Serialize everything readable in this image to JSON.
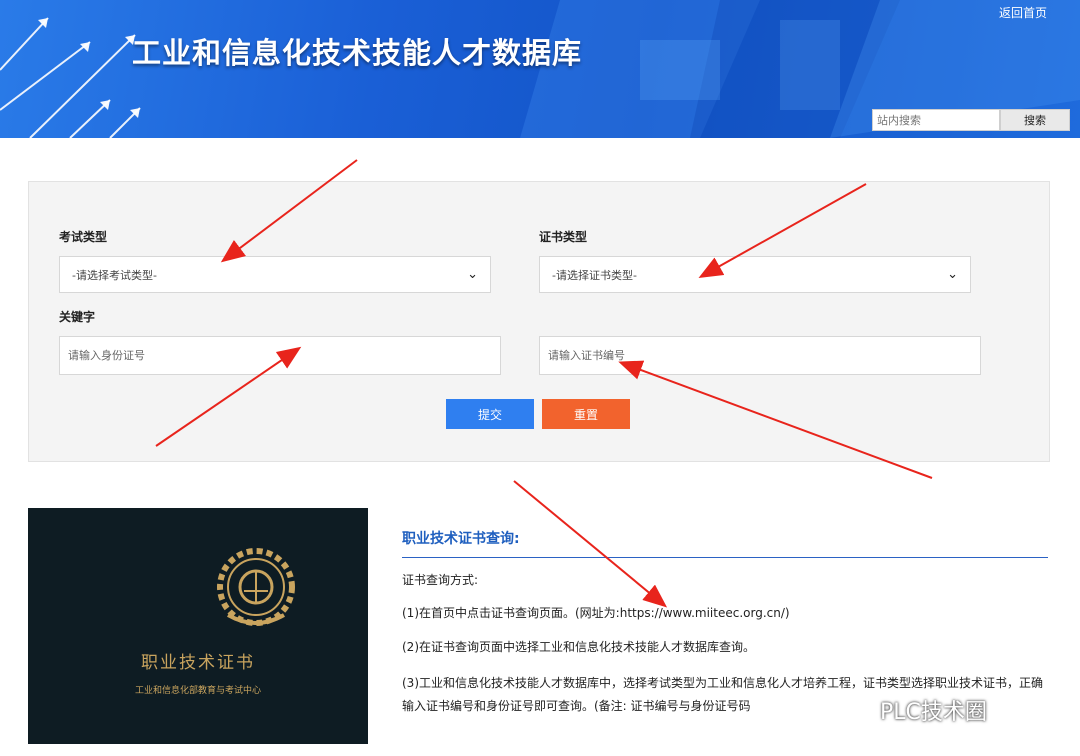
{
  "header": {
    "title": "工业和信息化技术技能人才数据库",
    "home_link": "返回首页",
    "search_placeholder": "站内搜索",
    "search_button": "搜索"
  },
  "form": {
    "exam_type_label": "考试类型",
    "exam_type_value": "-请选择考试类型-",
    "cert_type_label": "证书类型",
    "cert_type_value": "-请选择证书类型-",
    "keyword_label": "关键字",
    "id_placeholder": "请输入身份证号",
    "cert_no_placeholder": "请输入证书编号",
    "submit_label": "提交",
    "reset_label": "重置"
  },
  "certificate_image": {
    "title": "职业技术证书",
    "subtitle": "工业和信息化部教育与考试中心"
  },
  "info": {
    "title": "职业技术证书查询:",
    "paragraphs": [
      "证书查询方式:",
      "(1)在首页中点击证书查询页面。(网址为:https://www.miiteec.org.cn/)",
      "(2)在证书查询页面中选择工业和信息化技术技能人才数据库查询。",
      "(3)工业和信息化技术技能人才数据库中，选择考试类型为工业和信息化人才培养工程，证书类型选择职业技术证书，正确输入证书编号和身份证号即可查询。(备注: 证书编号与身份证号码"
    ]
  },
  "watermark": "PLC技术圈",
  "colors": {
    "banner_blue": "#1a5fd6",
    "submit_blue": "#2f7ff0",
    "reset_orange": "#f2632d",
    "title_blue": "#1f5fbf",
    "annotation_red": "#e8241c",
    "cert_gold": "#c9a45e"
  }
}
